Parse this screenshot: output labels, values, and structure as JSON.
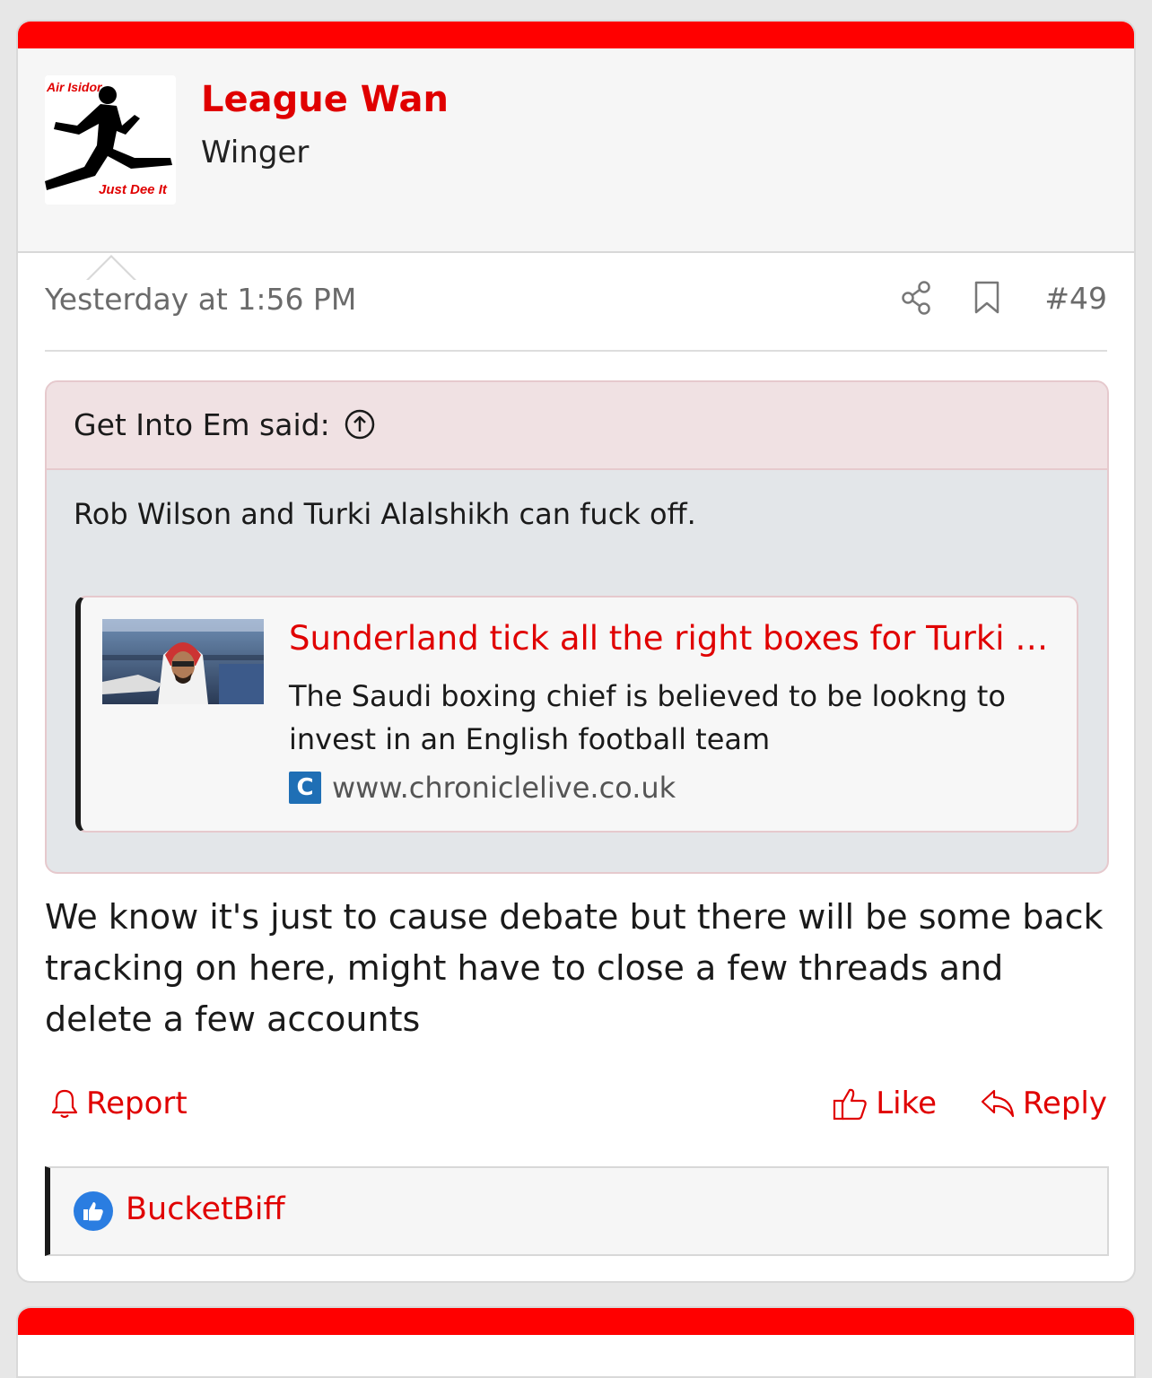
{
  "user": {
    "name": "League Wan",
    "title": "Winger",
    "avatar_text_top": "Air Isidor",
    "avatar_text_bottom": "Just Dee It"
  },
  "meta": {
    "date": "Yesterday at 1:56 PM",
    "post_number": "#49"
  },
  "quote": {
    "attribution": "Get Into Em said:",
    "text": "Rob Wilson and Turki Alalshikh can fuck off.",
    "unfurl": {
      "title": "Sunderland tick all the right boxes for Turki Alalshikh",
      "description": "The Saudi boxing chief is believed to be lookng to invest in an English football team",
      "favicon_letter": "C",
      "domain": "www.chroniclelive.co.uk"
    }
  },
  "body": "We know it's just to cause debate but there will be some back tracking on here, might have to close a few threads and delete a few accounts",
  "actions": {
    "report": "Report",
    "like": "Like",
    "reply": "Reply"
  },
  "reactions": {
    "user": "BucketBiff"
  },
  "colors": {
    "accent": "#e00000",
    "bar": "#ff0000",
    "like_badge": "#2a7de1"
  }
}
